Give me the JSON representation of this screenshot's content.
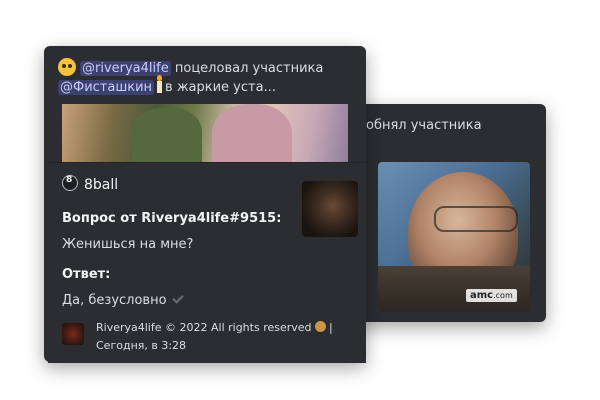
{
  "back_message": {
    "text": "обнял участника"
  },
  "gif_watermark": {
    "brand": "amc",
    "suffix": ".com"
  },
  "front_message": {
    "author": "@riverya4life",
    "action": "поцеловал участника",
    "target": "@Фисташкин",
    "rest": "в жаркие уста..."
  },
  "embed": {
    "title": "8ball",
    "question_title": "Вопрос от Riverya4life#9515:",
    "question": "Женишься на мне?",
    "answer_title": "Ответ:",
    "answer": "Да, безусловно",
    "footer_text": "Riverya4life © 2022 All rights reserved",
    "footer_separator": "|",
    "timestamp": "Сегодня, в 3:28"
  }
}
